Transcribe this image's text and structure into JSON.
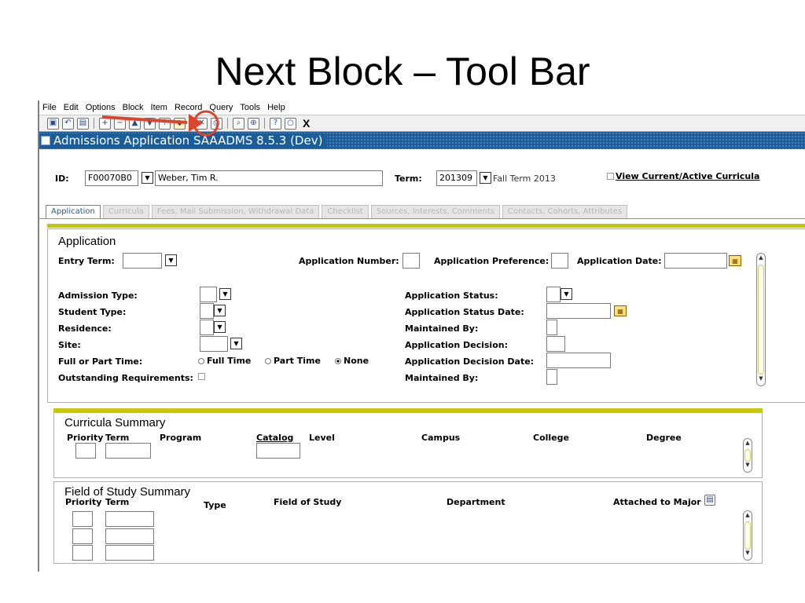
{
  "slide": {
    "title": "Next Block – Tool Bar"
  },
  "menu": {
    "items": [
      "File",
      "Edit",
      "Options",
      "Block",
      "Item",
      "Record",
      "Query",
      "Tools",
      "Help"
    ]
  },
  "toolbar": {
    "exit_label": "X"
  },
  "window": {
    "title": "Admissions Application  SAAADMS  8.5.3  (Dev)"
  },
  "key_block": {
    "id_label": "ID:",
    "id_value": "F00070B0",
    "name_value": "Weber, Tim R.",
    "term_label": "Term:",
    "term_value": "201309",
    "term_desc": "Fall Term 2013",
    "view_label": "View Current/Active Curricula"
  },
  "tabs": [
    "Application",
    "Curricula",
    "Fees, Mail Submission, Withdrawal Data",
    "Checklist",
    "Sources, Interests, Comments",
    "Contacts, Cohorts, Attributes"
  ],
  "application": {
    "title": "Application",
    "entry_term": "Entry Term:",
    "app_number": "Application Number:",
    "app_preference": "Application Preference:",
    "app_date": "Application Date:",
    "admission_type": "Admission Type:",
    "student_type": "Student Type:",
    "residence": "Residence:",
    "site": "Site:",
    "full_part": "Full or Part Time:",
    "full_time": "Full Time",
    "part_time": "Part Time",
    "none": "None",
    "outstanding": "Outstanding Requirements:",
    "app_status": "Application Status:",
    "app_status_date": "Application Status Date:",
    "maintained_by": "Maintained By:",
    "app_decision": "Application Decision:",
    "app_decision_date": "Application Decision Date:",
    "maintained_by2": "Maintained By:"
  },
  "curricula": {
    "title": "Curricula Summary",
    "headers": [
      "Priority",
      "Term",
      "Program",
      "Catalog",
      "Level",
      "Campus",
      "College",
      "Degree"
    ]
  },
  "field_study": {
    "title": "Field of Study Summary",
    "headers": [
      "Priority",
      "Term",
      "Type",
      "Field of Study",
      "Department",
      "Attached to Major"
    ]
  },
  "colors": {
    "title_bar": "#1b5d99",
    "accent_line": "#c8c800",
    "annotation": "#d9462b"
  },
  "icons": [
    "save-icon",
    "rollback-icon",
    "select-icon",
    "insert-record-icon",
    "remove-record-icon",
    "previous-block-icon",
    "next-block-icon",
    "enter-query-icon",
    "execute-query-icon",
    "cancel-query-icon",
    "print-icon",
    "search-icon",
    "help-icon",
    "exit-icon"
  ]
}
